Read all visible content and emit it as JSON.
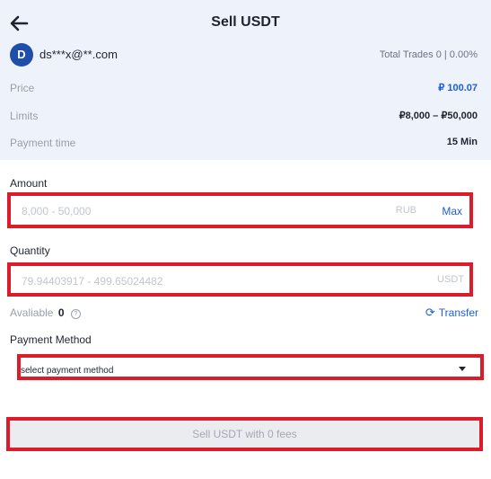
{
  "header": {
    "title": "Sell USDT",
    "back_icon": "arrow-left-icon"
  },
  "user": {
    "avatar_letter": "D",
    "email": "ds***x@**.com",
    "trades": "Total Trades 0 | 0.00%"
  },
  "info": [
    {
      "label": "Price",
      "value": "₽ 100.07"
    },
    {
      "label": "Limits",
      "value": "₽8,000 – ₽50,000"
    },
    {
      "label": "Payment time",
      "value": "15 Min"
    }
  ],
  "amount": {
    "label": "Amount",
    "placeholder": "8,000 - 50,000",
    "unit": "RUB",
    "max_label": "Max"
  },
  "quantity": {
    "label": "Quantity",
    "placeholder": "79.94403917 - 499.65024482",
    "unit": "USDT"
  },
  "available": {
    "label": "Avaliable",
    "value": "0",
    "transfer_label": "Transfer"
  },
  "payment": {
    "label": "Payment Method",
    "placeholder": "select payment method"
  },
  "submit": {
    "label": "Sell USDT with 0 fees"
  },
  "colors": {
    "accent": "#1b5fd6",
    "highlight": "#dc1c2a",
    "top_bg": "#eef2fb"
  }
}
